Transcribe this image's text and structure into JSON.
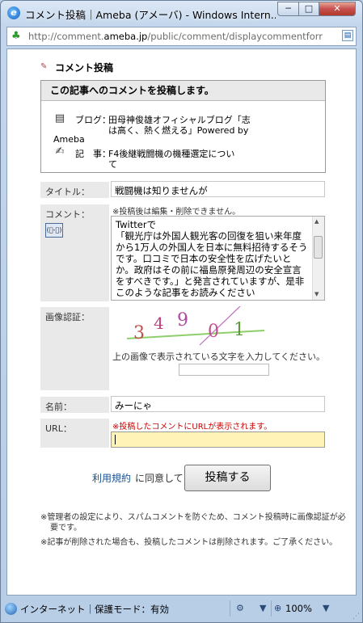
{
  "window": {
    "title": "コメント投稿｜Ameba (アメーバ) - Windows Intern...",
    "minimize": "─",
    "maximize": "□",
    "close": "✕"
  },
  "address": {
    "domain_prefix": "http://comment.",
    "domain": "ameba.jp",
    "path": "/public/comment/displaycommentforr"
  },
  "page": {
    "section_title": "コメント投稿",
    "box_heading": "この記事へのコメントを投稿します。",
    "blog_label": "ブログ：",
    "blog_value_1": "田母神俊雄オフィシャルブログ「志",
    "blog_value_2": "は高く、熱く燃える」Powered by",
    "blog_value_3": "Ameba",
    "article_label": "記　事：",
    "article_value_1": "F4後継戦闘機の機種選定につい",
    "article_value_2": "て",
    "title_label": "タイトル：",
    "title_value": "戦闘機は知りませんが",
    "comment_label": "コメント：",
    "emoticon": "(ﾟ-ﾟ)",
    "comment_note": "※投稿後は編集・削除できません。",
    "comment_text": "Twitterで\n「観光庁は外国人観光客の回復を狙い来年度から1万人の外国人を日本に無料招待するそうです。口コミで日本の安全性を広げたいとか。政府はその前に福島原発周辺の安全宣言をすべきです。」と発言されていますが、是非このような記事をお読みください\n\n「チェルノブイリ事故　福島で現われつつある健",
    "captcha_label": "画像認証：",
    "captcha_digits": [
      "3",
      "4",
      "9",
      "0",
      "1"
    ],
    "captcha_instruction": "上の画像で表示されている文字を入力してください。",
    "name_label": "名前：",
    "name_value": "みーにゃ",
    "url_label": "URL：",
    "url_note": "※投稿したコメントにURLが表示されます。",
    "terms_link": "利用規約",
    "agree_text": "に同意して",
    "submit_label": "投稿する",
    "footnote_1a": "※管理者の設定により、スパムコメントを防ぐため、コメント投稿時に画像認証が必",
    "footnote_1b": "要です。",
    "footnote_2": "※記事が削除された場合も、投稿したコメントは削除されます。ご了承ください。"
  },
  "status": {
    "zone": "インターネット｜保護モード：有効",
    "zoom": "100%"
  }
}
